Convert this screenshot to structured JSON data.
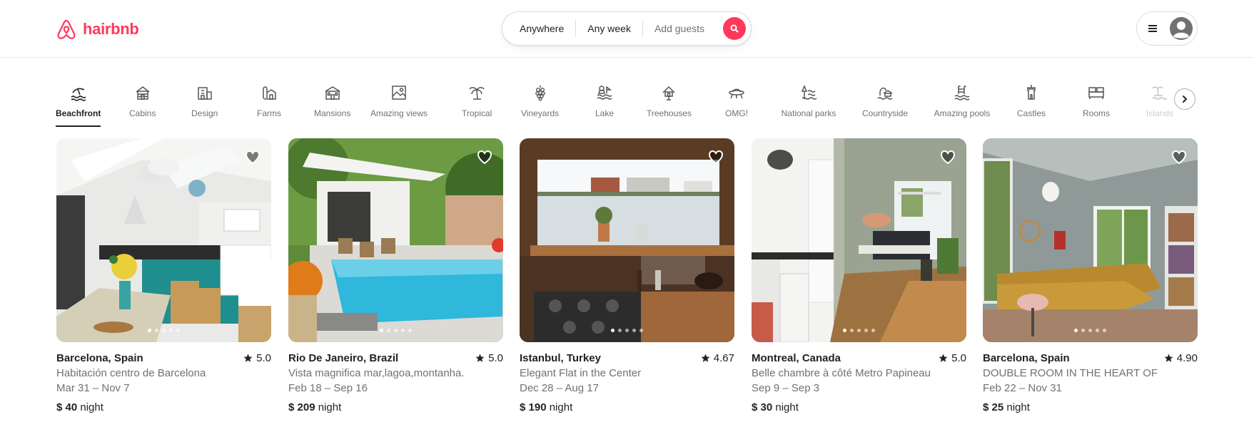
{
  "brand": {
    "name": "hairbnb",
    "accent": "#ff385c"
  },
  "search": {
    "location": "Anywhere",
    "dates": "Any week",
    "guests": "Add guests"
  },
  "categories": [
    {
      "label": "Beachfront",
      "icon": "beachfront-icon",
      "active": true
    },
    {
      "label": "Cabins",
      "icon": "cabin-icon"
    },
    {
      "label": "Design",
      "icon": "design-icon"
    },
    {
      "label": "Farms",
      "icon": "farm-icon"
    },
    {
      "label": "Mansions",
      "icon": "mansion-icon"
    },
    {
      "label": "Amazing views",
      "icon": "amazing-views-icon"
    },
    {
      "label": "Tropical",
      "icon": "palm-tree-icon"
    },
    {
      "label": "Vineyards",
      "icon": "grapes-icon"
    },
    {
      "label": "Lake",
      "icon": "lake-icon"
    },
    {
      "label": "Treehouses",
      "icon": "treehouse-icon"
    },
    {
      "label": "OMG!",
      "icon": "ufo-icon"
    },
    {
      "label": "National parks",
      "icon": "national-park-icon"
    },
    {
      "label": "Countryside",
      "icon": "countryside-icon"
    },
    {
      "label": "Amazing pools",
      "icon": "pool-icon"
    },
    {
      "label": "Castles",
      "icon": "castle-icon"
    },
    {
      "label": "Rooms",
      "icon": "bed-icon"
    },
    {
      "label": "Islands",
      "icon": "island-icon"
    }
  ],
  "listings": [
    {
      "location": "Barcelona, Spain",
      "rating": "5.0",
      "title": "Habitación centro de Barcelona",
      "dates": "Mar 31 – Nov 7",
      "price": "$ 40",
      "unit": "night"
    },
    {
      "location": "Rio De Janeiro, Brazil",
      "rating": "5.0",
      "title": "Vista magnifica mar,lagoa,montanha.",
      "dates": "Feb 18 – Sep 16",
      "price": "$ 209",
      "unit": "night"
    },
    {
      "location": "Istanbul, Turkey",
      "rating": "4.67",
      "title": "Elegant Flat in the Center",
      "dates": "Dec 28 – Aug 17",
      "price": "$ 190",
      "unit": "night"
    },
    {
      "location": "Montreal, Canada",
      "rating": "5.0",
      "title": "Belle chambre à côté Metro Papineau",
      "dates": "Sep 9 – Sep 3",
      "price": "$ 30",
      "unit": "night"
    },
    {
      "location": "Barcelona, Spain",
      "rating": "4.90",
      "title": "DOUBLE ROOM IN THE HEART OF",
      "dates": "Feb 22 – Nov 31",
      "price": "$ 25",
      "unit": "night"
    }
  ]
}
